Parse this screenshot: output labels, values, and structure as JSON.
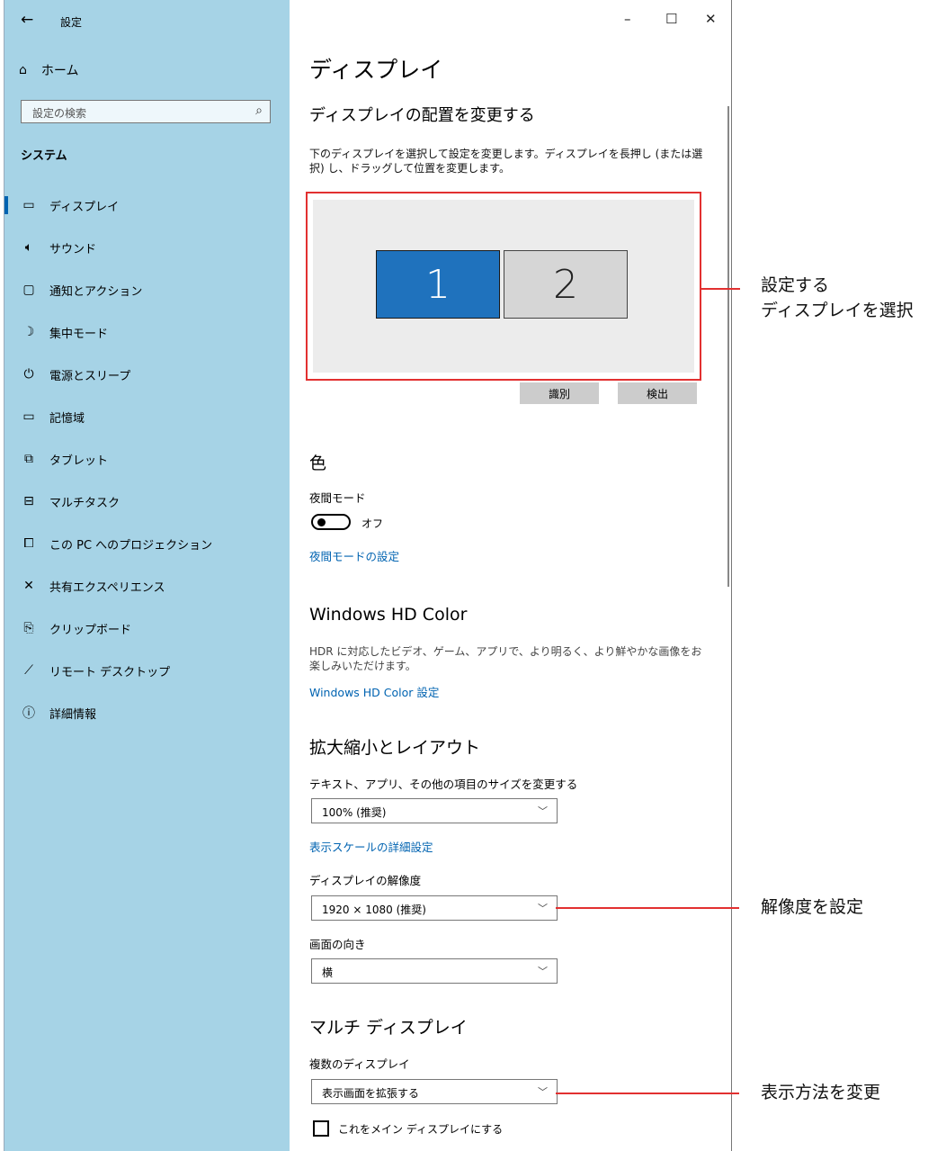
{
  "window": {
    "title": "設定",
    "back": "←",
    "controls": {
      "minimize": "–",
      "maximize": "☐",
      "close": "✕"
    }
  },
  "sidebar": {
    "home": {
      "icon": "home-icon",
      "label": "ホーム"
    },
    "search_placeholder": "設定の検索",
    "section": "システム",
    "items": [
      {
        "icon": "monitor-icon",
        "label": "ディスプレイ",
        "active": true
      },
      {
        "icon": "speaker-icon",
        "label": "サウンド"
      },
      {
        "icon": "notification-icon",
        "label": "通知とアクション"
      },
      {
        "icon": "moon-icon",
        "label": "集中モード"
      },
      {
        "icon": "power-icon",
        "label": "電源とスリープ"
      },
      {
        "icon": "storage-icon",
        "label": "記憶域"
      },
      {
        "icon": "tablet-icon",
        "label": "タブレット"
      },
      {
        "icon": "multitask-icon",
        "label": "マルチタスク"
      },
      {
        "icon": "projection-icon",
        "label": "この PC へのプロジェクション"
      },
      {
        "icon": "shared-experience-icon",
        "label": "共有エクスペリエンス"
      },
      {
        "icon": "clipboard-icon",
        "label": "クリップボード"
      },
      {
        "icon": "remote-desktop-icon",
        "label": "リモート デスクトップ"
      },
      {
        "icon": "info-icon",
        "label": "詳細情報"
      }
    ]
  },
  "main": {
    "title": "ディスプレイ",
    "arrangement": {
      "heading": "ディスプレイの配置を変更する",
      "description": "下のディスプレイを選択して設定を変更します。ディスプレイを長押し (または選択) し、ドラッグして位置を変更します。",
      "monitor1": "1",
      "monitor2": "2",
      "identify": "識別",
      "detect": "検出"
    },
    "color": {
      "heading": "色",
      "night_label": "夜間モード",
      "night_state": "オフ",
      "night_link": "夜間モードの設定"
    },
    "hdr": {
      "heading": "Windows HD Color",
      "description": "HDR に対応したビデオ、ゲーム、アプリで、より明るく、より鮮やかな画像をお楽しみいただけます。",
      "link": "Windows HD Color 設定"
    },
    "scale": {
      "heading": "拡大縮小とレイアウト",
      "size_label": "テキスト、アプリ、その他の項目のサイズを変更する",
      "size_value": "100% (推奨)",
      "advanced_link": "表示スケールの詳細設定",
      "resolution_label": "ディスプレイの解像度",
      "resolution_value": "1920 × 1080 (推奨)",
      "orientation_label": "画面の向き",
      "orientation_value": "横"
    },
    "multi": {
      "heading": "マルチ ディスプレイ",
      "label": "複数のディスプレイ",
      "value": "表示画面を拡張する",
      "checkbox": "これをメイン ディスプレイにする"
    }
  },
  "callouts": {
    "select_line1": "設定する",
    "select_line2": "ディスプレイを選択",
    "resolution": "解像度を設定",
    "display_mode": "表示方法を変更"
  },
  "colors": {
    "sidebar": "#a6d3e6",
    "accent": "#0063b1",
    "highlight": "#e23030",
    "monitor_selected": "#1f72bd"
  }
}
